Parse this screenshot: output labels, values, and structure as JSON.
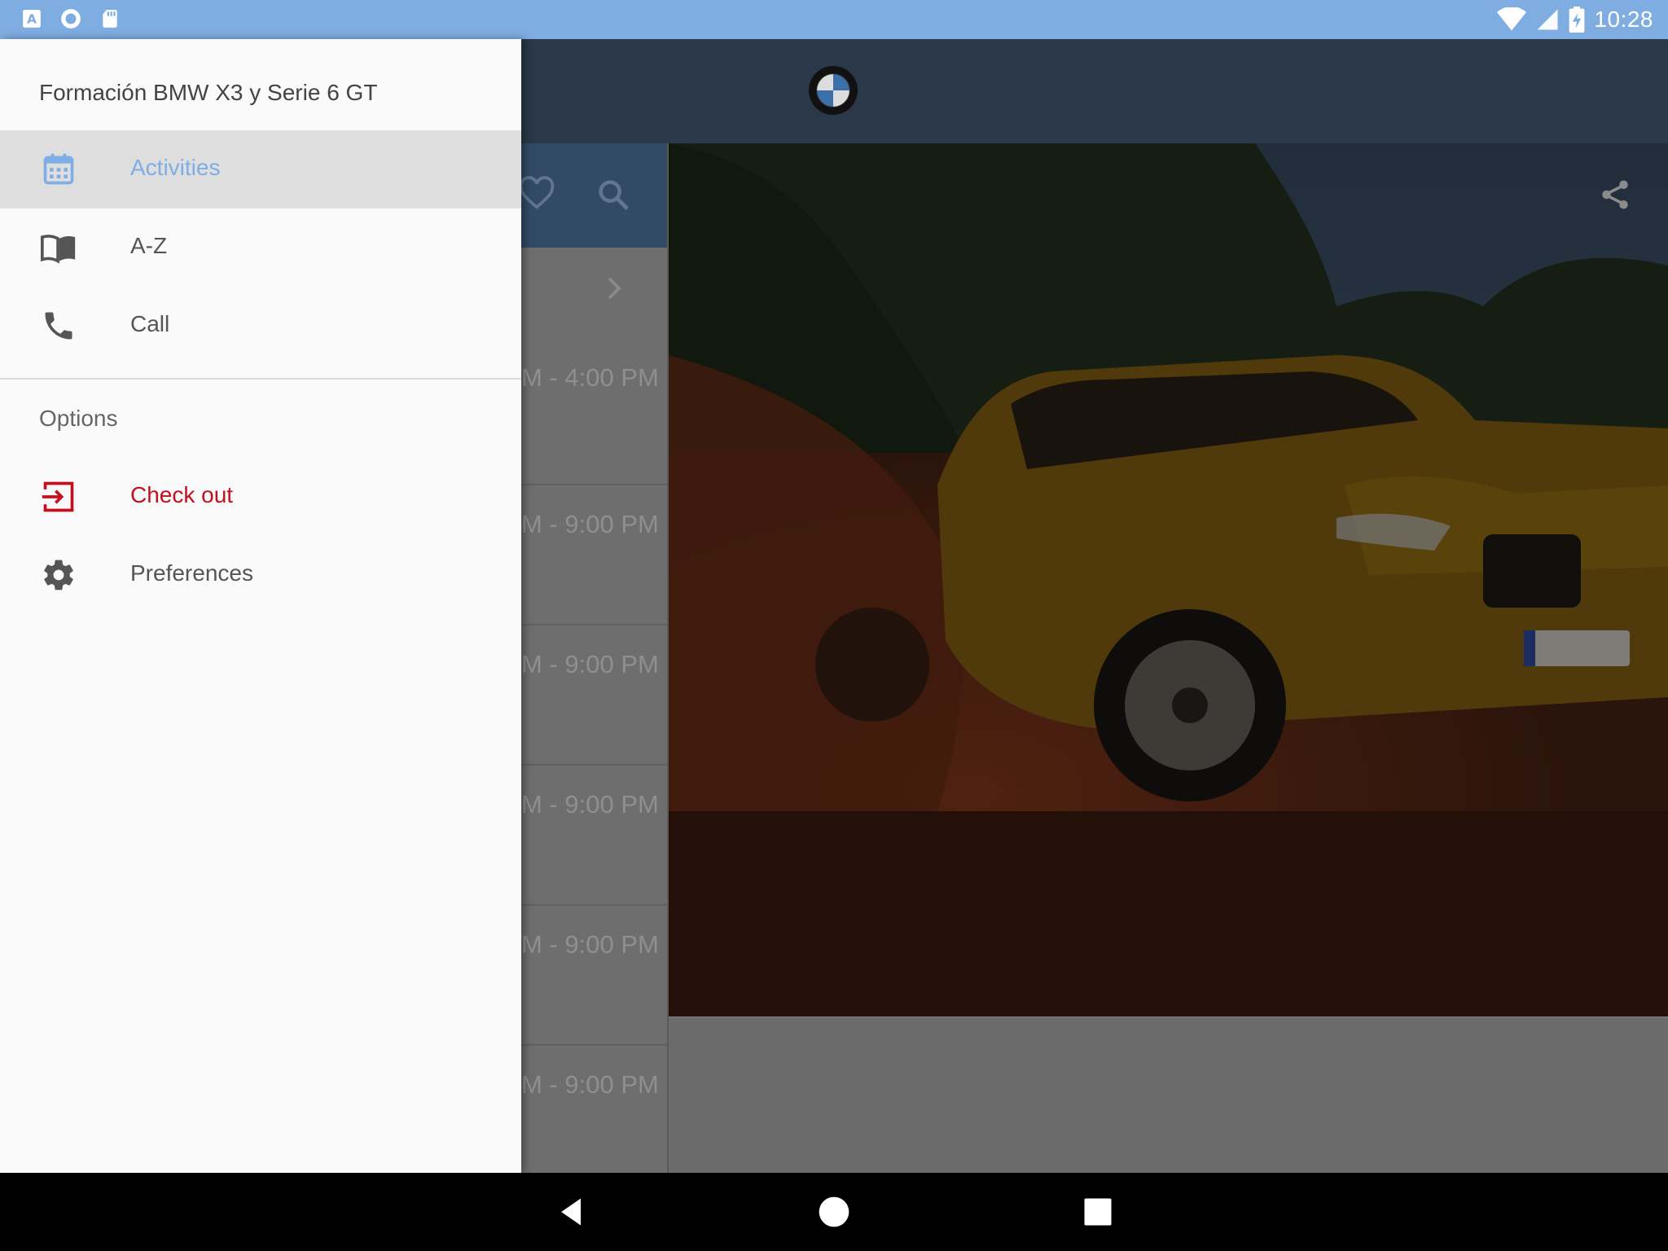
{
  "status_bar": {
    "time": "10:28",
    "left_icons": [
      "font-icon",
      "circle-app-icon",
      "sd-card-icon"
    ],
    "right_icons": [
      "wifi-icon",
      "signal-icon",
      "battery-charging-icon"
    ]
  },
  "drawer": {
    "title": "Formación BMW X3 y Serie 6 GT",
    "items": [
      {
        "label": "Activities",
        "icon": "calendar-icon",
        "active": true
      },
      {
        "label": "A-Z",
        "icon": "book-icon"
      },
      {
        "label": "Call",
        "icon": "phone-icon"
      }
    ],
    "options_header": "Options",
    "options": [
      {
        "label": "Check out",
        "icon": "exit-icon",
        "color": "#c4101e"
      },
      {
        "label": "Preferences",
        "icon": "gear-icon"
      }
    ]
  },
  "list": {
    "rows": [
      {
        "time": "M - 4:00 PM"
      },
      {
        "time": "M - 9:00 PM"
      },
      {
        "time": "M - 9:00 PM"
      },
      {
        "time": "M - 9:00 PM"
      },
      {
        "time": "M - 9:00 PM"
      },
      {
        "time": "M - 9:00 PM"
      }
    ]
  },
  "colors": {
    "status_bar": "#7fade2",
    "app_bar": "#2a3849",
    "accent": "#7eaee6",
    "danger": "#c4101e"
  }
}
